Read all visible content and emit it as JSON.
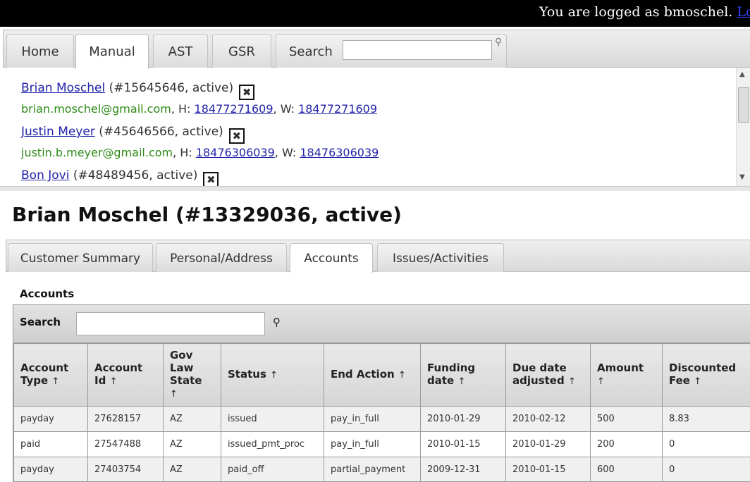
{
  "session": {
    "logged_text": "You are logged as bmoschel.",
    "logout_label": "Log Out"
  },
  "nav": {
    "tabs": [
      "Home",
      "Manual",
      "AST",
      "GSR",
      "Search"
    ],
    "active": "Manual",
    "search_value": ""
  },
  "results": [
    {
      "name": "Brian Moschel",
      "info": "(#15645646, active)",
      "email": "brian.moschel@gmail.com",
      "home_label": "H:",
      "home_phone": "18477271609",
      "work_label": "W:",
      "work_phone": "18477271609"
    },
    {
      "name": "Justin Meyer",
      "info": "(#45646566, active)",
      "email": "justin.b.meyer@gmail.com",
      "home_label": "H:",
      "home_phone": "18476306039",
      "work_label": "W:",
      "work_phone": "18476306039"
    },
    {
      "name": "Bon Jovi",
      "info": "(#48489456, active)"
    }
  ],
  "customer": {
    "title": "Brian Moschel (#13329036, active)"
  },
  "subtabs": {
    "tabs": [
      "Customer Summary",
      "Personal/Address",
      "Accounts",
      "Issues/Activities"
    ],
    "active": "Accounts"
  },
  "accounts": {
    "section_label": "Accounts",
    "search_label": "Search",
    "search_value": "",
    "sort_glyph": "↑",
    "columns": [
      [
        "Account",
        "Type"
      ],
      [
        "Account",
        "Id"
      ],
      [
        "Gov",
        "Law",
        "State"
      ],
      [
        "Status"
      ],
      [
        "End Action"
      ],
      [
        "Funding",
        "date"
      ],
      [
        "Due date",
        "adjusted"
      ],
      [
        "Amount"
      ],
      [
        "Discounted",
        "Fee"
      ]
    ],
    "rows": [
      [
        "payday",
        "27628157",
        "AZ",
        "issued",
        "pay_in_full",
        "2010-01-29",
        "2010-02-12",
        "500",
        "8.83"
      ],
      [
        "paid",
        "27547488",
        "AZ",
        "issued_pmt_proc",
        "pay_in_full",
        "2010-01-15",
        "2010-01-29",
        "200",
        "0"
      ],
      [
        "payday",
        "27403754",
        "AZ",
        "paid_off",
        "partial_payment",
        "2009-12-31",
        "2010-01-15",
        "600",
        "0"
      ]
    ]
  }
}
